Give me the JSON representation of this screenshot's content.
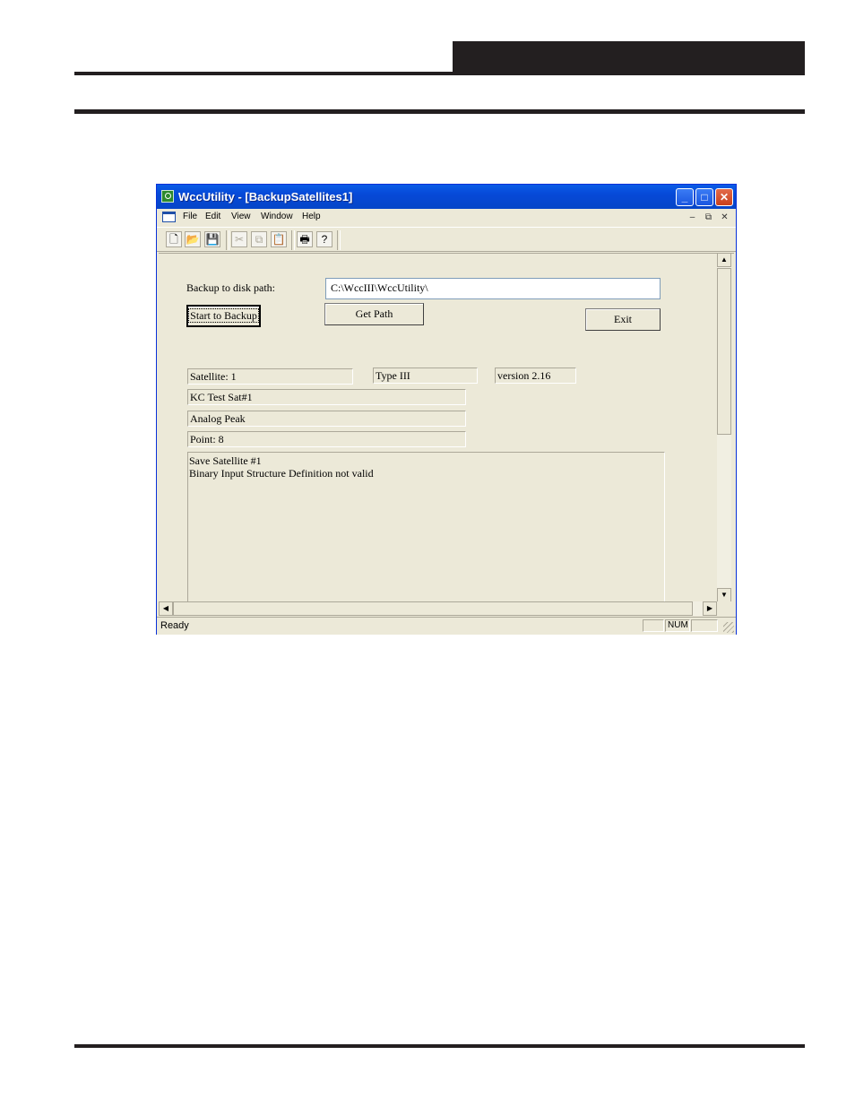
{
  "window": {
    "title": "WccUtility - [BackupSatellites1]"
  },
  "menu": {
    "items": [
      "File",
      "Edit",
      "View",
      "Window",
      "Help"
    ]
  },
  "toolbar": {
    "icons": [
      "new-icon",
      "open-icon",
      "save-icon",
      "cut-icon",
      "copy-icon",
      "paste-icon",
      "print-icon",
      "help-icon"
    ]
  },
  "form": {
    "backup_path_label": "Backup to disk path:",
    "backup_path_value": "C:\\WccIII\\WccUtility\\",
    "start_backup_label": "Start to Backup",
    "get_path_label": "Get Path",
    "exit_label": "Exit",
    "satellite": "Satellite: 1",
    "type": "Type III",
    "version": "version 2.16",
    "satellite_name": "KC Test Sat#1",
    "point_type": "Analog Peak",
    "point": "Point: 8",
    "log": [
      "Save Satellite #1",
      "Binary Input Structure Definition not valid"
    ]
  },
  "status": {
    "text": "Ready",
    "num": "NUM"
  }
}
